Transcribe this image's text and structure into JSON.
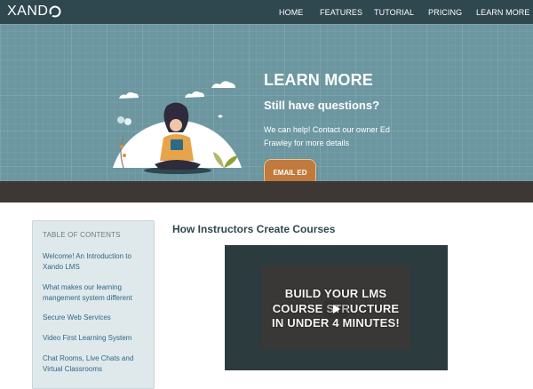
{
  "brand": {
    "logo_text": "XAND"
  },
  "nav": {
    "items": [
      "HOME",
      "FEATURES",
      "TUTORIAL",
      "PRICING",
      "LEARN MORE"
    ]
  },
  "hero": {
    "title": "LEARN MORE",
    "subtitle": "Still have questions?",
    "text": "We can help! Contact our owner Ed Frawley for more details",
    "button_label": "EMAIL ED"
  },
  "toc": {
    "heading": "TABLE OF CONTENTS",
    "items": [
      "Welcome! An Introduction to Xando LMS",
      "What makes our learning mangement system different",
      "Secure Web Services",
      "Video First Learning System",
      "Chat Rooms, Live Chats and Virtual Classrooms"
    ]
  },
  "article": {
    "title": "How Instructors Create Courses",
    "video": {
      "line1": "BUILD YOUR LMS",
      "line2": "COURSE STRUCTURE",
      "line3": "IN UNDER 4 MINUTES!"
    }
  },
  "colors": {
    "navbar": "#2f474f",
    "hero": "#6c97a1",
    "accent": "#bf7a3c",
    "band": "#3d3833",
    "toc_bg": "#dfe8ea",
    "link": "#2d6a87"
  },
  "icons": [
    "logo-o-icon",
    "play-icon",
    "illustration-person-reading"
  ]
}
